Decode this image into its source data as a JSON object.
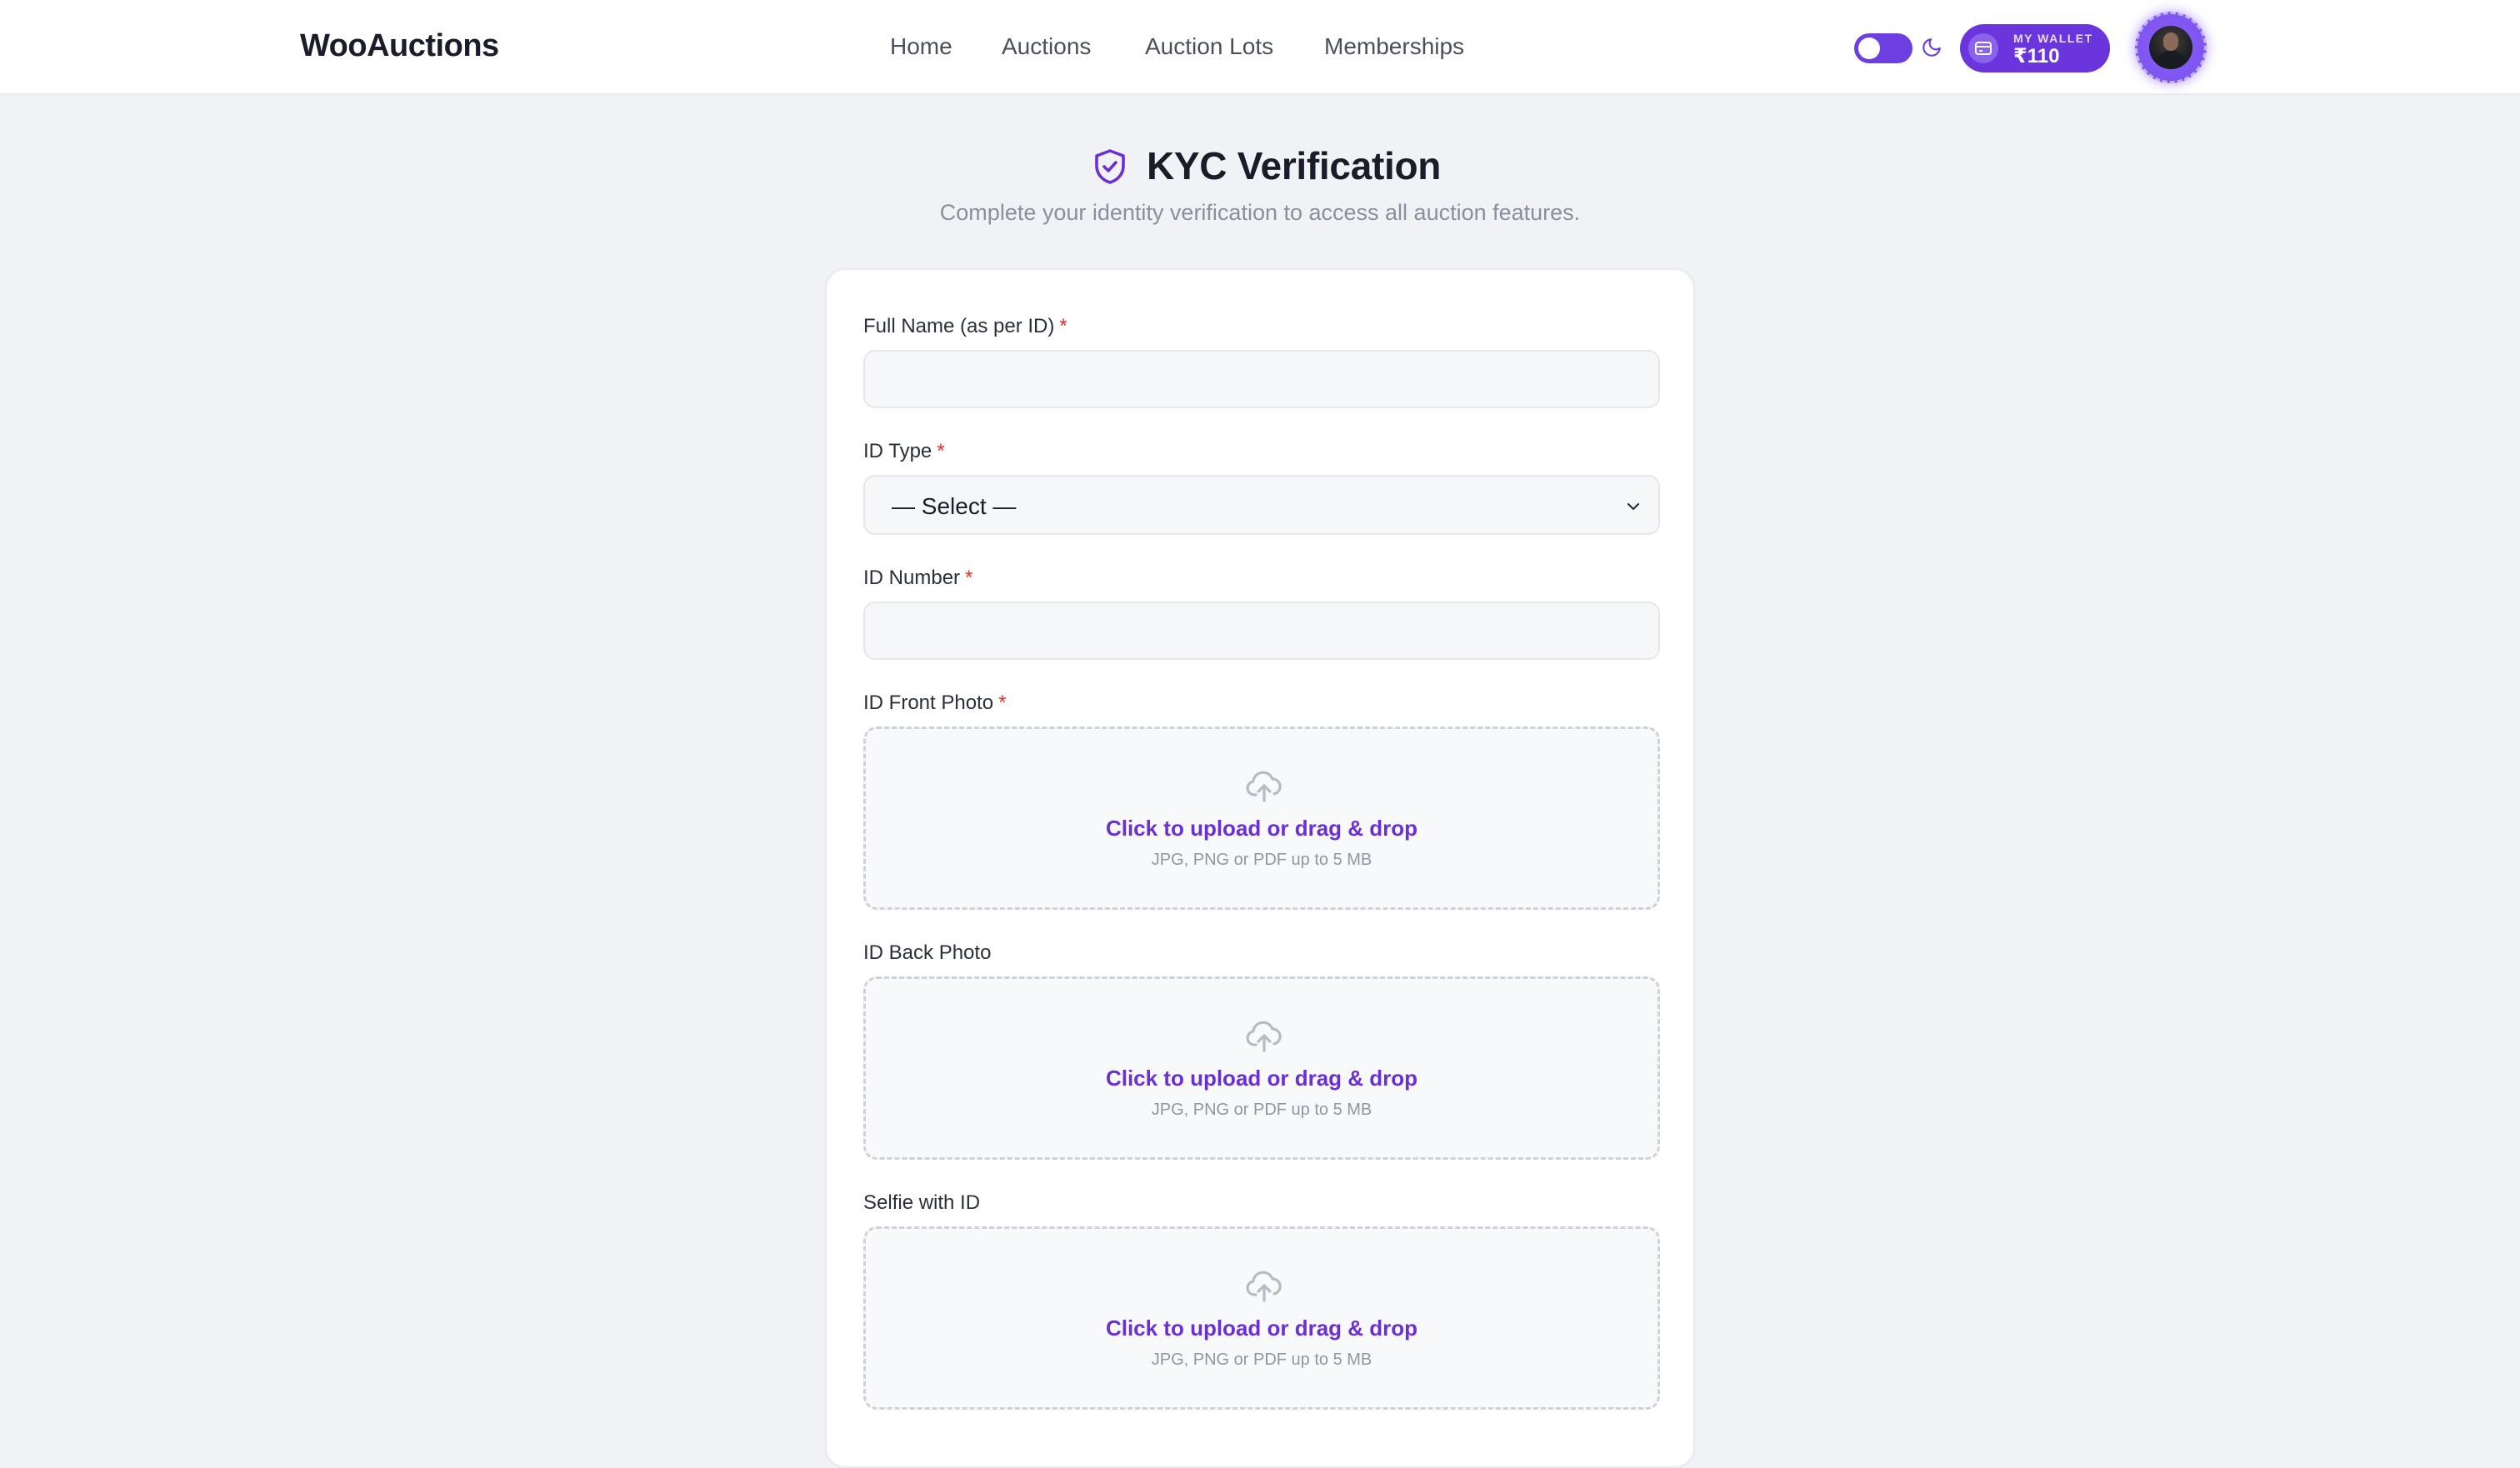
{
  "header": {
    "brand": "WooAuctions",
    "nav": {
      "home": "Home",
      "auctions": "Auctions",
      "lots": "Auction Lots",
      "memberships": "Memberships"
    },
    "wallet": {
      "label": "MY WALLET",
      "amount": "₹110"
    },
    "icons": [
      "moon-icon",
      "wallet-icon",
      "avatar"
    ]
  },
  "page": {
    "title": "KYC Verification",
    "subtitle": "Complete your identity verification to access all auction features.",
    "icon": "shield-check-icon"
  },
  "form": {
    "full_name": {
      "label": "Full Name (as per ID)",
      "required_mark": "*",
      "value": ""
    },
    "id_type": {
      "label": "ID Type",
      "required_mark": "*",
      "selected": "— Select —"
    },
    "id_number": {
      "label": "ID Number",
      "required_mark": "*",
      "value": ""
    },
    "front_photo": {
      "label": "ID Front Photo",
      "required_mark": "*",
      "upload_text": "Click to upload or drag & drop",
      "hint": "JPG, PNG or PDF up to 5 MB"
    },
    "back_photo": {
      "label": "ID Back Photo",
      "upload_text": "Click to upload or drag & drop",
      "hint": "JPG, PNG or PDF up to 5 MB"
    },
    "selfie": {
      "label": "Selfie with ID",
      "upload_text": "Click to upload or drag & drop",
      "hint": "JPG, PNG or PDF up to 5 MB"
    }
  },
  "colors": {
    "accent": "#6b2fd6",
    "wallet_bg": "#6a35dd",
    "required": "#e0342b",
    "page_bg": "#f1f2f5"
  }
}
